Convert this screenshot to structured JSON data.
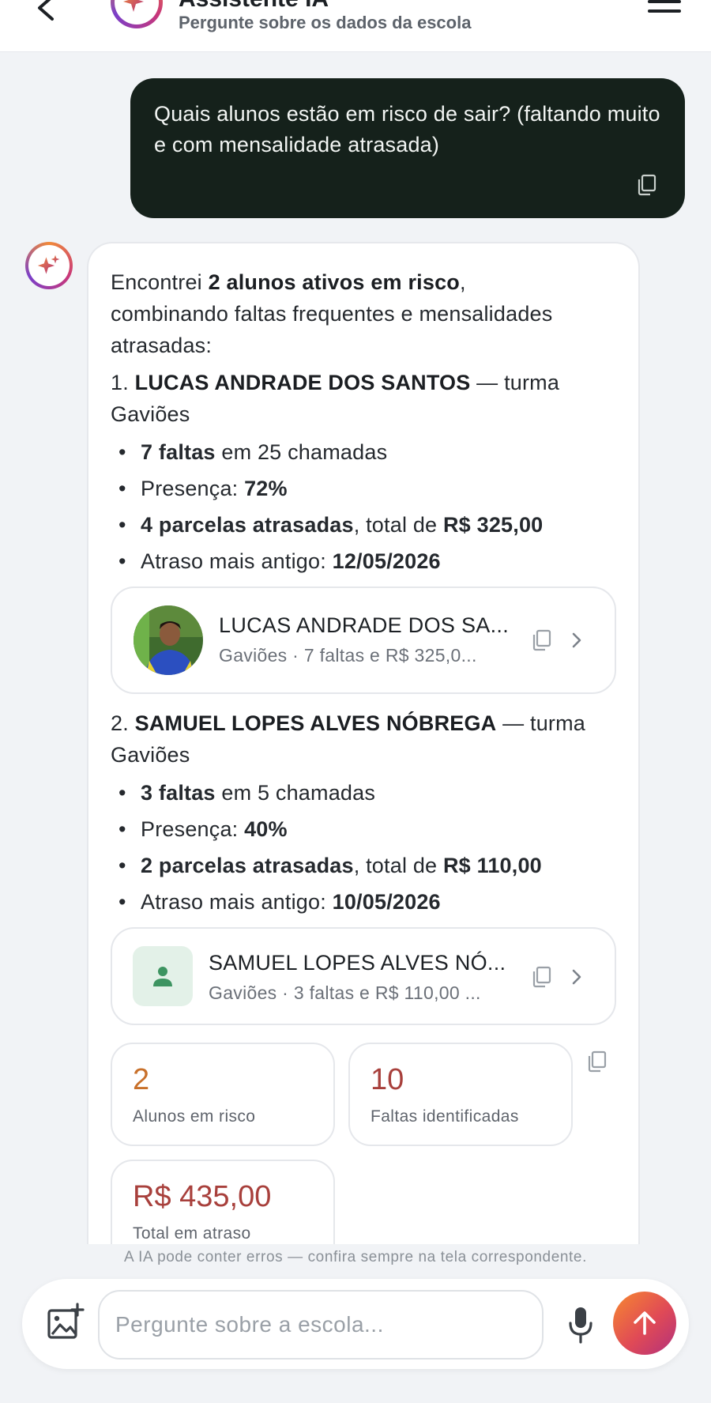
{
  "header": {
    "title": "Assistente IA",
    "subtitle": "Pergunte sobre os dados da escola"
  },
  "user_message": "Quais alunos estão em risco de sair? (faltando muito e com mensalidade atrasada)",
  "assistant": {
    "intro_pre": "Encontrei ",
    "intro_bold": "2 alunos ativos em risco",
    "intro_post": ",",
    "intro_line2": "combinando faltas frequentes e mensalidades",
    "intro_line3": "atrasadas:",
    "students": [
      {
        "num": "1.",
        "name": "LUCAS ANDRADE DOS SANTOS",
        "turma_sep": " — turma",
        "turma": "Gaviões",
        "b1_bold": "7 faltas",
        "b1_rest": " em 25 chamadas",
        "b2_label": "Presença: ",
        "b2_bold": "72%",
        "b3_bold": "4 parcelas atrasadas",
        "b3_mid": ", total de ",
        "b3_amount": "R$ 325,00",
        "b4_label": "Atraso mais antigo: ",
        "b4_bold": "12/05/2026",
        "card_name": "LUCAS ANDRADE DOS SA...",
        "card_sub": "Gaviões · 7 faltas e R$ 325,0..."
      },
      {
        "num": "2.",
        "name": "SAMUEL LOPES ALVES NÓBREGA",
        "turma_sep": " — turma",
        "turma": "Gaviões",
        "b1_bold": "3 faltas",
        "b1_rest": " em 5 chamadas",
        "b2_label": "Presença: ",
        "b2_bold": "40%",
        "b3_bold": "2 parcelas atrasadas",
        "b3_mid": ", total de ",
        "b3_amount": "R$ 110,00",
        "b4_label": "Atraso mais antigo: ",
        "b4_bold": "10/05/2026",
        "card_name": "SAMUEL LOPES ALVES NÓ...",
        "card_sub": "Gaviões · 3 faltas e R$ 110,00 ..."
      }
    ],
    "stats": [
      {
        "value": "2",
        "label": "Alunos em risco",
        "color": "#c8702a"
      },
      {
        "value": "10",
        "label": "Faltas identificadas",
        "color": "#a8403c"
      },
      {
        "value": "R$ 435,00",
        "label": "Total em atraso",
        "color": "#a8403c"
      }
    ]
  },
  "disclaimer": "A IA pode conter erros — confira sempre na tela correspondente.",
  "composer": {
    "placeholder": "Pergunte sobre a escola..."
  },
  "icons": {
    "back": "chevron-left-icon",
    "menu": "hamburger-menu-icon",
    "sparkle": "sparkle-icon",
    "copy": "copy-icon",
    "chevron": "chevron-right-icon",
    "person": "person-icon",
    "attach": "add-image-icon",
    "mic": "microphone-icon",
    "send": "arrow-up-icon"
  },
  "colors": {
    "user_bubble": "#15211b",
    "accent_orange": "#f7892f",
    "accent_pink": "#b2307c",
    "placeholder_bg": "#e3f1e8",
    "person_green": "#3d9461"
  }
}
